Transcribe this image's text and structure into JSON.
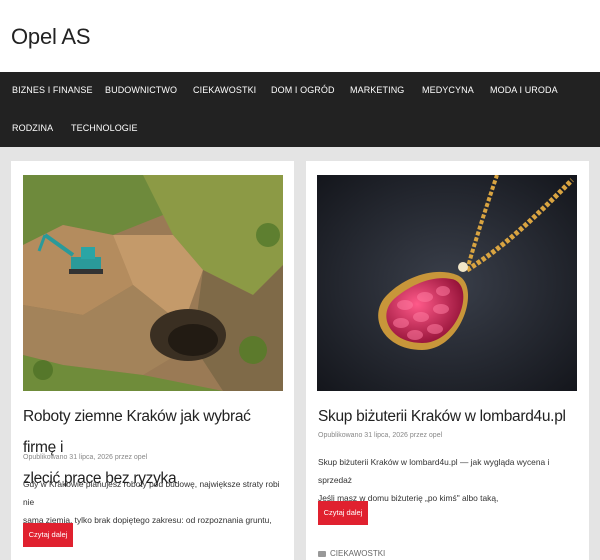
{
  "site": {
    "title": "Opel AS"
  },
  "nav": {
    "items": [
      "BIZNES I FINANSE",
      "BUDOWNICTWO",
      "CIEKAWOSTKI",
      "DOM I OGRÓD",
      "MARKETING",
      "MEDYCYNA",
      "MODA I URODA",
      "RODZINA",
      "TECHNOLOGIE"
    ]
  },
  "posts": [
    {
      "image_alt": "excavator-on-hillside",
      "title_line1": "Roboty ziemne Kraków jak wybrać firmę i",
      "title_line2": "zlecić prace bez ryzyka",
      "meta": "Opublikowano 31 lipca, 2026 przez opel",
      "excerpt_line1": "Gdy w Krakowie planujesz roboty pod budowę, największe straty robi nie",
      "excerpt_line2": "sama ziemia, tylko brak dopiętego zakresu: od rozpoznania gruntu,",
      "button": "Czytaj dalej"
    },
    {
      "image_alt": "ruby-pendant",
      "title_line1": "Skup biżuterii Kraków w lombard4u.pl",
      "meta": "Opublikowano 31 lipca, 2026 przez opel",
      "excerpt_line1": "Skup biżuterii Kraków w lombard4u.pl — jak wygląda wycena i sprzedaż",
      "excerpt_line2": "Jeśli masz w domu biżuterię „po kimś\" albo taką,",
      "button": "Czytaj dalej",
      "category": "CIEKAWOSTKI"
    }
  ],
  "colors": {
    "nav_bg": "#222222",
    "button": "#e0212f",
    "page_bg": "#e4e4e4"
  }
}
